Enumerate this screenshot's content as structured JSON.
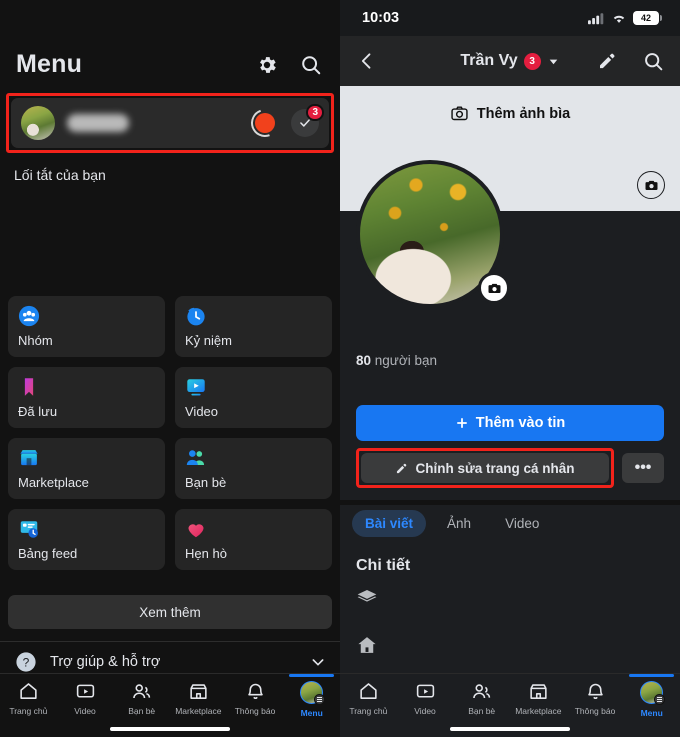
{
  "left": {
    "header": {
      "title": "Menu",
      "settings_icon": "gear-icon",
      "search_icon": "search-icon"
    },
    "profile_row": {
      "name_masked": "",
      "badge_count": "3",
      "story_ring_label": ""
    },
    "shortcut_label": "Lối tắt của bạn",
    "grid": [
      {
        "label": "Nhóm",
        "icon": "groups-icon"
      },
      {
        "label": "Kỷ niệm",
        "icon": "memories-clock-icon"
      },
      {
        "label": "Đã lưu",
        "icon": "bookmark-icon"
      },
      {
        "label": "Video",
        "icon": "video-icon"
      },
      {
        "label": "Marketplace",
        "icon": "marketplace-store-icon"
      },
      {
        "label": "Bạn bè",
        "icon": "friends-icon"
      },
      {
        "label": "Bảng feed",
        "icon": "feeds-icon"
      },
      {
        "label": "Hẹn hò",
        "icon": "dating-heart-icon"
      }
    ],
    "see_more": "Xem thêm",
    "help": {
      "label": "Trợ giúp & hỗ trợ",
      "icon": "help-question-icon",
      "chevron": "chevron-down-icon"
    },
    "bottom_nav": [
      {
        "label": "Trang chủ",
        "icon": "home-icon",
        "active": false
      },
      {
        "label": "Video",
        "icon": "video-icon",
        "active": false
      },
      {
        "label": "Bạn bè",
        "icon": "friends-icon",
        "active": false
      },
      {
        "label": "Marketplace",
        "icon": "marketplace-icon",
        "active": false
      },
      {
        "label": "Thông báo",
        "icon": "bell-icon",
        "active": false
      },
      {
        "label": "Menu",
        "icon": "avatar-menu-icon",
        "active": true
      }
    ]
  },
  "right": {
    "status_bar": {
      "time": "10:03",
      "battery": "42",
      "signal_icon": "cellular-signal-icon",
      "wifi_icon": "wifi-icon"
    },
    "app_bar": {
      "back_icon": "back-chevron-icon",
      "title": "Trần Vy",
      "badge": "3",
      "dropdown_icon": "chevron-down-icon",
      "edit_icon": "pencil-icon",
      "search_icon": "search-icon"
    },
    "cover": {
      "add_cover_label": "Thêm ảnh bìa",
      "camera_icon": "camera-icon"
    },
    "friends_count_number": "80",
    "friends_count_label": " người bạn",
    "buttons": {
      "add_story": "Thêm vào tin",
      "add_story_icon": "plus-icon",
      "edit_profile": "Chỉnh sửa trang cá nhân",
      "edit_profile_icon": "pencil-icon",
      "more": "•••"
    },
    "tabs": [
      {
        "label": "Bài viết",
        "active": true
      },
      {
        "label": "Ảnh",
        "active": false
      },
      {
        "label": "Video",
        "active": false
      }
    ],
    "details_title": "Chi tiết",
    "detail_items": [
      {
        "icon": "education-cap-icon"
      },
      {
        "icon": "home-icon"
      }
    ],
    "bottom_nav": [
      {
        "label": "Trang chủ",
        "icon": "home-icon",
        "active": false
      },
      {
        "label": "Video",
        "icon": "video-icon",
        "active": false
      },
      {
        "label": "Bạn bè",
        "icon": "friends-icon",
        "active": false
      },
      {
        "label": "Marketplace",
        "icon": "marketplace-icon",
        "active": false
      },
      {
        "label": "Thông báo",
        "icon": "bell-icon",
        "active": false
      },
      {
        "label": "Menu",
        "icon": "avatar-menu-icon",
        "active": true
      }
    ]
  },
  "annotations": {
    "highlight_color": "#f2231b"
  }
}
